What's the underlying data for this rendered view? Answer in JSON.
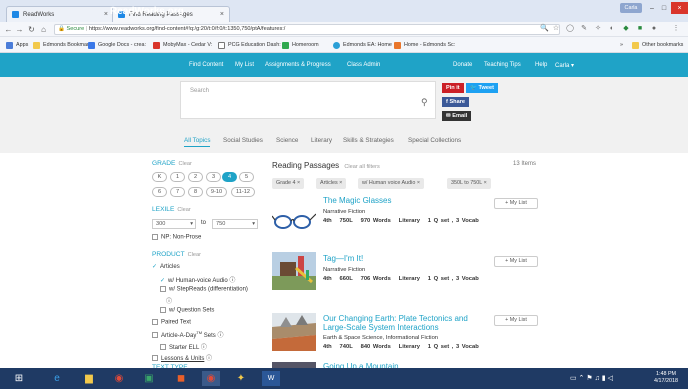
{
  "browser": {
    "tabs": [
      {
        "label": "ReadWorks"
      },
      {
        "label": "Find Reading Passages"
      }
    ],
    "profile_label": "Carla",
    "secure_label": "Secure",
    "url": "https://www.readworks.org/find-content#!q:/g:20/t:0/f:0/t:1350,750/ptA/features:/",
    "bookmarks": [
      {
        "label": "Apps",
        "color": "#4a7cd8"
      },
      {
        "label": "Edmonds Bookmarks",
        "color": "#f2c94c"
      },
      {
        "label": "Google Docs - crea:",
        "color": "#3a78e8"
      },
      {
        "label": "MobyMax - Cedar V:",
        "color": "#d9352b"
      },
      {
        "label": "PCG Education Dash:",
        "color": "#777777"
      },
      {
        "label": "Homeroom",
        "color": "#2fa84f"
      },
      {
        "label": "Edmonds EA: Home",
        "color": "#2a9fd6"
      },
      {
        "label": "Home - Edmonds Sc:",
        "color": "#e9762b"
      },
      {
        "label": "Other bookmarks",
        "color": "#f2c94c"
      }
    ]
  },
  "site": {
    "logo": "ReadWorks.org",
    "nav_left": [
      "Find Content",
      "My List",
      "Assignments & Progress",
      "Class Admin"
    ],
    "nav_right": [
      "Donate",
      "Teaching Tips",
      "Help",
      "Carla ▾"
    ],
    "search_placeholder": "Search",
    "share": {
      "pin": "Pin it",
      "tweet": "Tweet",
      "share": "Share",
      "email": "Email"
    },
    "subtabs": [
      "All Topics",
      "Social Studies",
      "Science",
      "Literary",
      "Skills & Strategies",
      "Special Collections"
    ]
  },
  "filters": {
    "grade_label": "GRADE",
    "clear_label": "Clear",
    "grades_row1": [
      "K",
      "1",
      "2",
      "3",
      "4",
      "5"
    ],
    "grades_row2": [
      "6",
      "7",
      "8",
      "9-10",
      "11-12"
    ],
    "selected_grade": "4",
    "lexile_label": "LEXILE",
    "lexile_min": "300",
    "lexile_to": "to",
    "lexile_max": "750",
    "np_label": "NP: Non-Prose",
    "product_label": "PRODUCT",
    "articles": "Articles",
    "audio": "w/ Human-voice Audio",
    "stepreads": "w/ StepReads (differentiation)",
    "question_sets": "w/ Question Sets",
    "paired": "Paired Text",
    "article_a_day": "Article-A-Day",
    "tm": "TM",
    "sets": "Sets",
    "starter": "Starter ELL",
    "lessons": "Lessons & Units",
    "text_type": "TEXT TYPE"
  },
  "results": {
    "title": "Reading Passages",
    "clear_all": "Clear all filters",
    "count": "13 Items",
    "chips": [
      "Grade 4 ×",
      "Articles ×",
      "w/ Human voice Audio ×",
      "350L to 750L ×"
    ],
    "my_list_label": "+ My List",
    "passages": [
      {
        "title": "The Magic Glasses",
        "genre": "Narrative Fiction",
        "grade": "4th",
        "lexile": "750L",
        "words": "970 Words",
        "type": "Literary",
        "sets": "1 Q set , 3 Vocab"
      },
      {
        "title": "Tag—I'm It!",
        "genre": "Narrative Fiction",
        "grade": "4th",
        "lexile": "660L",
        "words": "706 Words",
        "type": "Literary",
        "sets": "1 Q set , 3 Vocab"
      },
      {
        "title": "Our Changing Earth: Plate Tectonics and",
        "title2": "Large-Scale System Interactions",
        "genre": "Earth & Space Science, Informational Fiction",
        "grade": "4th",
        "lexile": "740L",
        "words": "840 Words",
        "type": "Literary",
        "sets": "1 Q set , 3 Vocab"
      },
      {
        "title": "Going Up a Mountain"
      }
    ]
  },
  "taskbar": {
    "time": "1:48 PM",
    "date": "4/17/2018"
  }
}
